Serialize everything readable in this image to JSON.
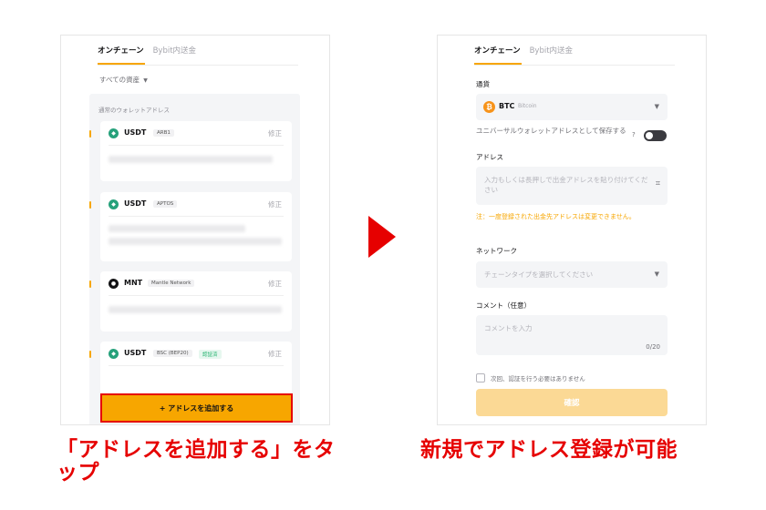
{
  "left_screen": {
    "tabs": [
      "オンチェーン",
      "Bybit内送金"
    ],
    "asset_filter": "すべての資産",
    "wallet_section_title": "通常のウォレットアドレス",
    "edit_label": "修正",
    "cards": [
      {
        "coin": "USDT",
        "chain": "ARB1",
        "verified": ""
      },
      {
        "coin": "USDT",
        "chain": "APTOS",
        "verified": ""
      },
      {
        "coin": "MNT",
        "chain": "Mantle Network",
        "verified": ""
      },
      {
        "coin": "USDT",
        "chain": "BSC (BEP20)",
        "verified": "認証済"
      }
    ],
    "add_button": "+ アドレスを追加する"
  },
  "right_screen": {
    "tabs": [
      "オンチェーン",
      "Bybit内送金"
    ],
    "currency_label": "通貨",
    "currency_code": "BTC",
    "currency_name": "Bitcoin",
    "universal_label": "ユニバーサルウォレットアドレスとして保存する",
    "address_label": "アドレス",
    "address_placeholder": "入力もしくは長押しで出金アドレスを貼り付けてください",
    "warning": "注：一度登録された出金先アドレスは変更できません。",
    "network_label": "ネットワーク",
    "network_placeholder": "チェーンタイプを選択してください",
    "comment_label": "コメント（任意）",
    "comment_placeholder": "コメントを入力",
    "comment_counter": "0/20",
    "checkbox_label": "次回、認証を行う必要はありません",
    "confirm_button": "確認"
  },
  "captions": {
    "left": "「アドレスを追加する」をタップ",
    "right": "新規でアドレス登録が可能"
  },
  "colors": {
    "accent": "#f7a600",
    "highlight": "#e60000",
    "usdt": "#26a17b",
    "btc": "#f7931a",
    "mnt": "#121214"
  }
}
